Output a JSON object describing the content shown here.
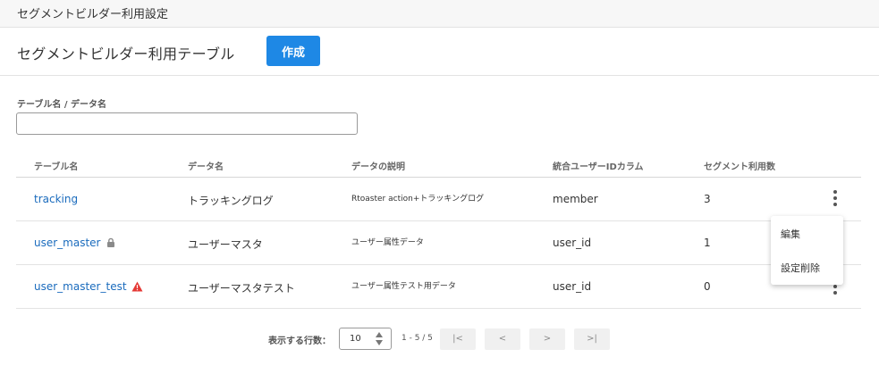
{
  "topbar": {
    "title": "セグメントビルダー利用設定"
  },
  "header": {
    "title": "セグメントビルダー利用テーブル",
    "create_label": "作成"
  },
  "filter": {
    "label": "テーブル名 / データ名",
    "value": "",
    "placeholder": ""
  },
  "table": {
    "columns": [
      "テーブル名",
      "データ名",
      "データの説明",
      "統合ユーザーIDカラム",
      "セグメント利用数"
    ],
    "rows": [
      {
        "table_name": "tracking",
        "data_name": "トラッキングログ",
        "description": "Rtoaster action+トラッキングログ",
        "user_id_column": "member",
        "segment_count": "3",
        "status_icon": ""
      },
      {
        "table_name": "user_master",
        "data_name": "ユーザーマスタ",
        "description": "ユーザー属性データ",
        "user_id_column": "user_id",
        "segment_count": "1",
        "status_icon": "lock-icon"
      },
      {
        "table_name": "user_master_test",
        "data_name": "ユーザーマスタテスト",
        "description": "ユーザー属性テスト用データ",
        "user_id_column": "user_id",
        "segment_count": "0",
        "status_icon": "warning-icon"
      }
    ]
  },
  "row_menu": {
    "items": [
      "編集",
      "設定削除"
    ]
  },
  "pagination": {
    "rows_label": "表示する行数：",
    "rows_value": "10",
    "range": "1 - 5 / 5",
    "first_label": "|<",
    "prev_label": "<",
    "next_label": ">",
    "last_label": ">|"
  },
  "colors": {
    "accent": "#1e88e5",
    "link": "#1a6bbd",
    "warning": "#e53935",
    "lock": "#8a8a8a"
  }
}
